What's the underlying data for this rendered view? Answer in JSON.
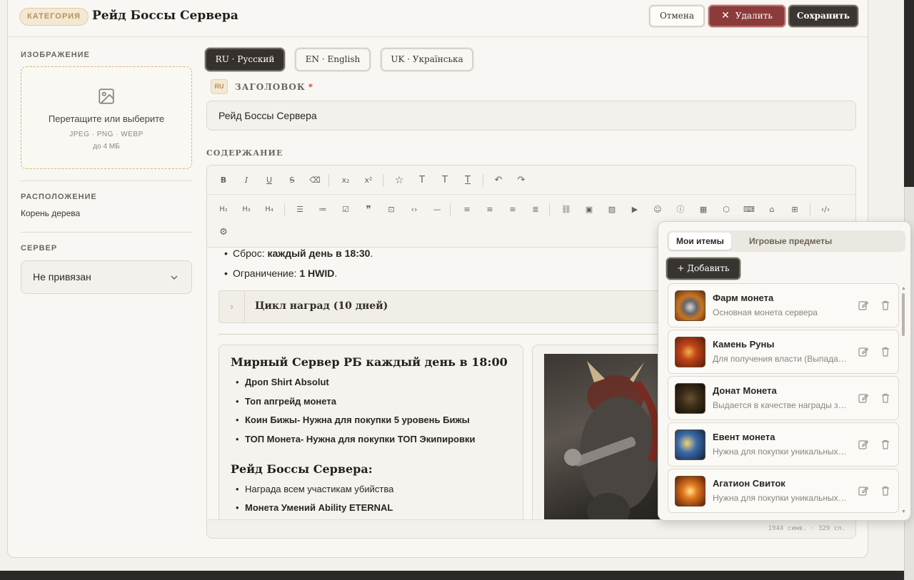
{
  "header": {
    "category_badge": "КАТЕГОРИЯ",
    "title": "Рейд Боссы Сервера",
    "cancel_label": "Отмена",
    "delete_label": "Удалить",
    "save_label": "Сохранить"
  },
  "sidebar": {
    "image_label": "ИЗОБРАЖЕНИЕ",
    "drop_text": "Перетащите или выберите",
    "formats": "JPEG · PNG · WEBP",
    "max_size": "до 4 МБ",
    "location_label": "РАСПОЛОЖЕНИЕ",
    "location_value": "Корень дерева",
    "server_label": "СЕРВЕР",
    "server_value": "Не привязан"
  },
  "lang_tabs": [
    {
      "label": "RU · Русский",
      "active": true
    },
    {
      "label": "EN · English",
      "active": false
    },
    {
      "label": "UK · Українська",
      "active": false
    }
  ],
  "title_field": {
    "lang_badge": "RU",
    "label": "ЗАГОЛОВОК",
    "required_mark": "*",
    "value": "Рейд Боссы Сервера"
  },
  "content": {
    "label": "СОДЕРЖАНИЕ",
    "top_lines": [
      {
        "prefix": "Сброс: ",
        "bold": "каждый день в 18:30",
        "suffix": "."
      },
      {
        "prefix": "Ограничение: ",
        "bold": "1 HWID",
        "suffix": "."
      }
    ],
    "accordion_title": "Цикл наград (10 дней)",
    "card_heading": "Мирный Сервер РБ каждый день в 18:00",
    "card_bullets": [
      "Дроп Shirt Absolut",
      "Топ апгрейд монета",
      "Коин Бижы- Нужна для покупки 5 уровень Бижы",
      "ТОП Монета- Нужна для покупки ТОП Экипировки"
    ],
    "card_heading2": "Рейд Боссы Сервера:",
    "card_bullets2": [
      "Награда всем участикам убийства",
      "Монета Умений Ability ETERNAL"
    ],
    "stats": "1944 симв. · 329 сл."
  },
  "items_panel": {
    "tab_mine": "Мои итемы",
    "tab_game": "Игровые предметы",
    "add_label": "+ Добавить",
    "items": [
      {
        "name": "Фарм монета",
        "desc": "Основная монета сервера",
        "icon": "farm-coin-icon",
        "color": "#c9741f"
      },
      {
        "name": "Камень Руны",
        "desc": "Для получения власти (Выпада…",
        "icon": "rune-stone-icon",
        "color": "#b4421e"
      },
      {
        "name": "Донат Монета",
        "desc": "Выдается в качестве награды з…",
        "icon": "donate-coin-icon",
        "color": "#4a3a22"
      },
      {
        "name": "Евент монета",
        "desc": "Нужна для покупки уникальных…",
        "icon": "event-coin-icon",
        "color": "#3a6aa8"
      },
      {
        "name": "Агатион Свиток",
        "desc": "Нужна для покупки уникальных…",
        "icon": "agathion-scroll-icon",
        "color": "#d0621a"
      }
    ]
  }
}
